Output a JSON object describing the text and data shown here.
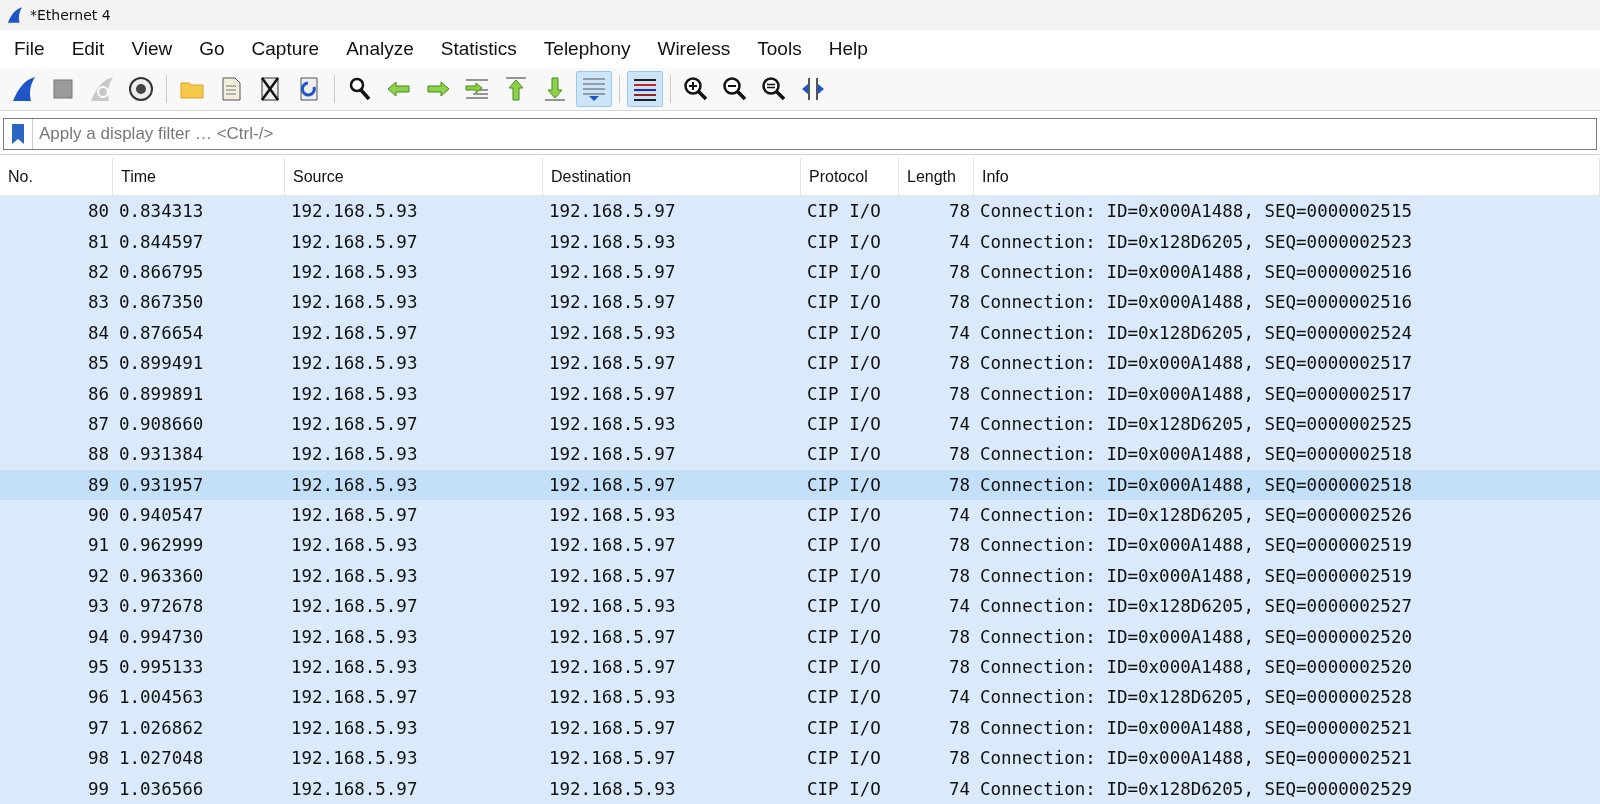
{
  "window": {
    "title": "*Ethernet 4"
  },
  "menu": [
    "File",
    "Edit",
    "View",
    "Go",
    "Capture",
    "Analyze",
    "Statistics",
    "Telephony",
    "Wireless",
    "Tools",
    "Help"
  ],
  "toolbar": [
    [
      {
        "kind": "fin",
        "pressed": false
      },
      {
        "kind": "stop",
        "pressed": false
      },
      {
        "kind": "restart",
        "pressed": false
      },
      {
        "kind": "options",
        "pressed": false
      }
    ],
    [
      {
        "kind": "open",
        "pressed": false
      },
      {
        "kind": "save",
        "pressed": false
      },
      {
        "kind": "close",
        "pressed": false
      },
      {
        "kind": "reload",
        "pressed": false
      }
    ],
    [
      {
        "kind": "find",
        "pressed": false
      },
      {
        "kind": "back",
        "pressed": false
      },
      {
        "kind": "forward",
        "pressed": false
      },
      {
        "kind": "jump",
        "pressed": false
      },
      {
        "kind": "first",
        "pressed": false
      },
      {
        "kind": "last",
        "pressed": false
      },
      {
        "kind": "autoscroll",
        "pressed": true
      }
    ],
    [
      {
        "kind": "colorize",
        "pressed": true
      }
    ],
    [
      {
        "kind": "zoomin",
        "pressed": false
      },
      {
        "kind": "zoomout",
        "pressed": false
      },
      {
        "kind": "zoomreset",
        "pressed": false
      },
      {
        "kind": "resize",
        "pressed": false
      }
    ]
  ],
  "filter": {
    "placeholder": "Apply a display filter … <Ctrl-/>"
  },
  "table": {
    "columns": [
      "No.",
      "Time",
      "Source",
      "Destination",
      "Protocol",
      "Length",
      "Info"
    ],
    "rows": [
      {
        "cells": [
          "80",
          "0.834313",
          "192.168.5.93",
          "192.168.5.97",
          "CIP I/O",
          "78",
          "Connection: ID=0x000A1488, SEQ=0000002515"
        ],
        "highlighted": false
      },
      {
        "cells": [
          "81",
          "0.844597",
          "192.168.5.97",
          "192.168.5.93",
          "CIP I/O",
          "74",
          "Connection: ID=0x128D6205, SEQ=0000002523"
        ],
        "highlighted": false
      },
      {
        "cells": [
          "82",
          "0.866795",
          "192.168.5.93",
          "192.168.5.97",
          "CIP I/O",
          "78",
          "Connection: ID=0x000A1488, SEQ=0000002516"
        ],
        "highlighted": false
      },
      {
        "cells": [
          "83",
          "0.867350",
          "192.168.5.93",
          "192.168.5.97",
          "CIP I/O",
          "78",
          "Connection: ID=0x000A1488, SEQ=0000002516"
        ],
        "highlighted": false
      },
      {
        "cells": [
          "84",
          "0.876654",
          "192.168.5.97",
          "192.168.5.93",
          "CIP I/O",
          "74",
          "Connection: ID=0x128D6205, SEQ=0000002524"
        ],
        "highlighted": false
      },
      {
        "cells": [
          "85",
          "0.899491",
          "192.168.5.93",
          "192.168.5.97",
          "CIP I/O",
          "78",
          "Connection: ID=0x000A1488, SEQ=0000002517"
        ],
        "highlighted": false
      },
      {
        "cells": [
          "86",
          "0.899891",
          "192.168.5.93",
          "192.168.5.97",
          "CIP I/O",
          "78",
          "Connection: ID=0x000A1488, SEQ=0000002517"
        ],
        "highlighted": false
      },
      {
        "cells": [
          "87",
          "0.908660",
          "192.168.5.97",
          "192.168.5.93",
          "CIP I/O",
          "74",
          "Connection: ID=0x128D6205, SEQ=0000002525"
        ],
        "highlighted": false
      },
      {
        "cells": [
          "88",
          "0.931384",
          "192.168.5.93",
          "192.168.5.97",
          "CIP I/O",
          "78",
          "Connection: ID=0x000A1488, SEQ=0000002518"
        ],
        "highlighted": false
      },
      {
        "cells": [
          "89",
          "0.931957",
          "192.168.5.93",
          "192.168.5.97",
          "CIP I/O",
          "78",
          "Connection: ID=0x000A1488, SEQ=0000002518"
        ],
        "highlighted": true
      },
      {
        "cells": [
          "90",
          "0.940547",
          "192.168.5.97",
          "192.168.5.93",
          "CIP I/O",
          "74",
          "Connection: ID=0x128D6205, SEQ=0000002526"
        ],
        "highlighted": false
      },
      {
        "cells": [
          "91",
          "0.962999",
          "192.168.5.93",
          "192.168.5.97",
          "CIP I/O",
          "78",
          "Connection: ID=0x000A1488, SEQ=0000002519"
        ],
        "highlighted": false
      },
      {
        "cells": [
          "92",
          "0.963360",
          "192.168.5.93",
          "192.168.5.97",
          "CIP I/O",
          "78",
          "Connection: ID=0x000A1488, SEQ=0000002519"
        ],
        "highlighted": false
      },
      {
        "cells": [
          "93",
          "0.972678",
          "192.168.5.97",
          "192.168.5.93",
          "CIP I/O",
          "74",
          "Connection: ID=0x128D6205, SEQ=0000002527"
        ],
        "highlighted": false
      },
      {
        "cells": [
          "94",
          "0.994730",
          "192.168.5.93",
          "192.168.5.97",
          "CIP I/O",
          "78",
          "Connection: ID=0x000A1488, SEQ=0000002520"
        ],
        "highlighted": false
      },
      {
        "cells": [
          "95",
          "0.995133",
          "192.168.5.93",
          "192.168.5.97",
          "CIP I/O",
          "78",
          "Connection: ID=0x000A1488, SEQ=0000002520"
        ],
        "highlighted": false
      },
      {
        "cells": [
          "96",
          "1.004563",
          "192.168.5.97",
          "192.168.5.93",
          "CIP I/O",
          "74",
          "Connection: ID=0x128D6205, SEQ=0000002528"
        ],
        "highlighted": false
      },
      {
        "cells": [
          "97",
          "1.026862",
          "192.168.5.93",
          "192.168.5.97",
          "CIP I/O",
          "78",
          "Connection: ID=0x000A1488, SEQ=0000002521"
        ],
        "highlighted": false
      },
      {
        "cells": [
          "98",
          "1.027048",
          "192.168.5.93",
          "192.168.5.97",
          "CIP I/O",
          "78",
          "Connection: ID=0x000A1488, SEQ=0000002521"
        ],
        "highlighted": false
      },
      {
        "cells": [
          "99",
          "1.036566",
          "192.168.5.97",
          "192.168.5.93",
          "CIP I/O",
          "74",
          "Connection: ID=0x128D6205, SEQ=0000002529"
        ],
        "highlighted": false
      }
    ]
  }
}
